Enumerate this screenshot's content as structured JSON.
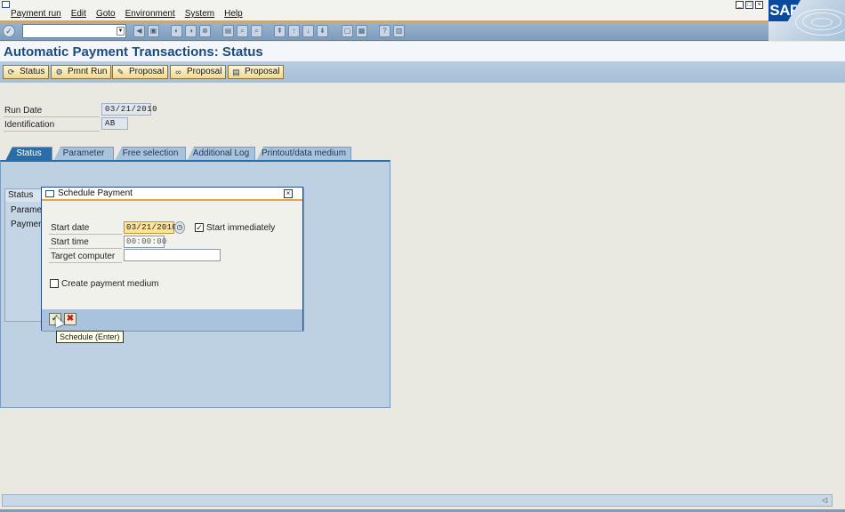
{
  "menu": {
    "items": [
      "Payment run",
      "Edit",
      "Goto",
      "Environment",
      "System",
      "Help"
    ]
  },
  "brand": {
    "logo_text": "SAP"
  },
  "title": "Automatic Payment Transactions: Status",
  "app_toolbar": {
    "buttons": [
      {
        "label": "Status",
        "icon": "refresh-icon"
      },
      {
        "label": "Pmnt Run",
        "icon": "payment-run-icon"
      },
      {
        "label": "Proposal",
        "icon": "pencil-icon"
      },
      {
        "label": "Proposal",
        "icon": "glasses-icon"
      },
      {
        "label": "Proposal",
        "icon": "document-icon"
      }
    ]
  },
  "header_fields": {
    "run_date_label": "Run Date",
    "run_date_value": "03/21/2010",
    "identification_label": "Identification",
    "identification_value": "AB"
  },
  "tabs": [
    {
      "label": "Status",
      "active": true
    },
    {
      "label": "Parameter",
      "active": false
    },
    {
      "label": "Free selection",
      "active": false
    },
    {
      "label": "Additional Log",
      "active": false
    },
    {
      "label": "Printout/data medium",
      "active": false
    }
  ],
  "status_group": {
    "header": "Status",
    "items": [
      "Paramet",
      "Paymen"
    ]
  },
  "dialog": {
    "title": "Schedule Payment",
    "start_date_label": "Start date",
    "start_date_value": "03/21/2010",
    "start_immediately_label": "Start immediately",
    "start_immediately_checked": true,
    "start_time_label": "Start time",
    "start_time_value": "00:00:00",
    "target_computer_label": "Target computer",
    "target_computer_value": "",
    "create_medium_label": "Create payment medium",
    "create_medium_checked": false,
    "tooltip": "Schedule   (Enter)"
  },
  "colors": {
    "accent_orange": "#e8a33b",
    "toolbar_blue": "#7d9cbd",
    "title_blue": "#1e4a7c",
    "focus_yellow": "#fde49a"
  }
}
